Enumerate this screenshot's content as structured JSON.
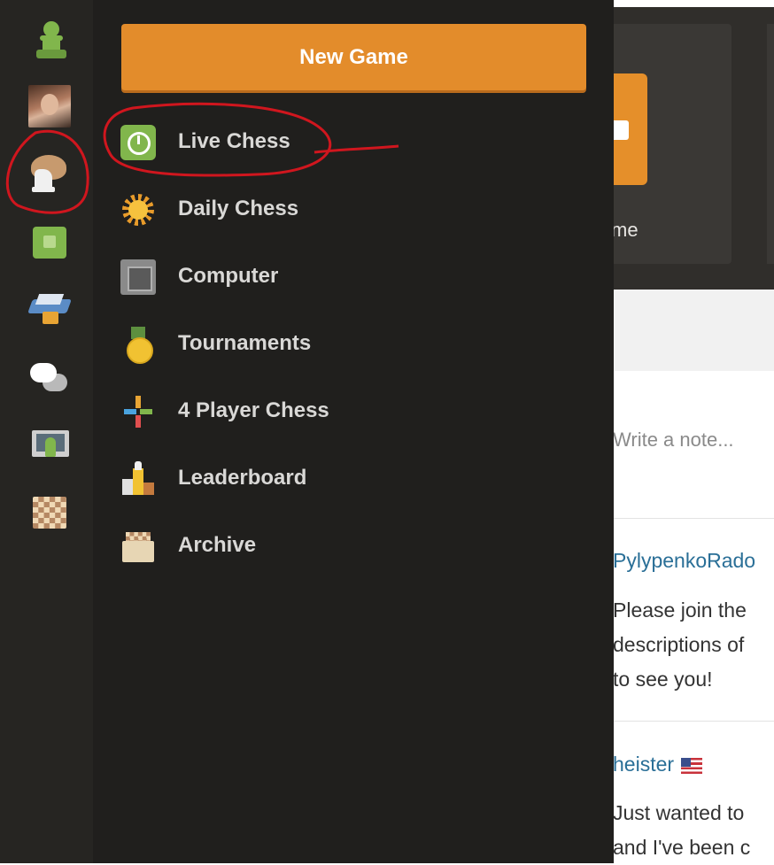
{
  "background_page": {
    "card_label": "me",
    "note_placeholder": "Write a note...",
    "posts": [
      {
        "user": "PylypenkoRado",
        "lines": [
          "Please join the",
          "descriptions of",
          "to see you!"
        ]
      },
      {
        "user": "heister",
        "lines": [
          "Just wanted to",
          "and I've been c"
        ]
      }
    ]
  },
  "sidebar": {
    "icons": [
      "pawn-icon",
      "avatar",
      "play-hand-icon",
      "puzzle-icon",
      "learn-icon",
      "chat-icon",
      "watch-icon",
      "board-icon"
    ]
  },
  "menu": {
    "new_game_label": "New Game",
    "items": [
      {
        "label": "Live Chess",
        "icon": "live-chess-clock-icon"
      },
      {
        "label": "Daily Chess",
        "icon": "sun-icon"
      },
      {
        "label": "Computer",
        "icon": "computer-chip-icon"
      },
      {
        "label": "Tournaments",
        "icon": "medal-icon"
      },
      {
        "label": "4 Player Chess",
        "icon": "four-arrows-icon"
      },
      {
        "label": "Leaderboard",
        "icon": "leaderboard-icon"
      },
      {
        "label": "Archive",
        "icon": "archive-box-icon"
      }
    ]
  },
  "colors": {
    "accent_orange": "#e38c2b",
    "annotation_red": "#d0161e",
    "menu_bg": "#201f1d",
    "rail_bg": "#262522",
    "link_blue": "#2a6f97"
  }
}
